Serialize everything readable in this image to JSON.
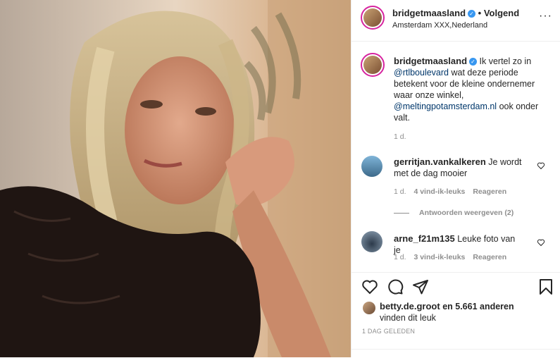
{
  "post": {
    "username": "bridgetmaasland",
    "follow_label": "• Volgend",
    "location": "Amsterdam XXX,Nederland",
    "more_label": "···"
  },
  "caption": {
    "username": "bridgetmaasland",
    "text_1": "Ik vertel zo in",
    "mention_1": "@rtlboulevard",
    "text_2": "wat deze periode betekent voor de kleine ondernemer waar onze winkel,",
    "mention_2": "@meltingpotamsterdam.nl",
    "text_3": "ook onder valt.",
    "time": "1 d."
  },
  "comments": [
    {
      "username": "gerritjan.vankalkeren",
      "text": "Je wordt met de dag mooier",
      "time": "1 d.",
      "likes": "4 vind-ik-leuks",
      "reply": "Reageren",
      "view_replies": "Antwoorden weergeven (2)"
    },
    {
      "username": "arne_f21m135",
      "text": "Leuke foto van je",
      "time": "1 d.",
      "likes": "3 vind-ik-leuks",
      "reply": "Reageren"
    }
  ],
  "likes": {
    "user": "betty.de.groot",
    "text": "en 5.661 anderen",
    "suffix": "vinden dit leuk"
  },
  "date": "1 DAG GELEDEN",
  "icons": {
    "like": "heart-icon",
    "comment": "comment-icon",
    "share": "share-icon",
    "save": "bookmark-icon"
  },
  "colors": {
    "verified": "#3897f0",
    "mention": "#00376b",
    "muted": "#8e8e8e"
  }
}
